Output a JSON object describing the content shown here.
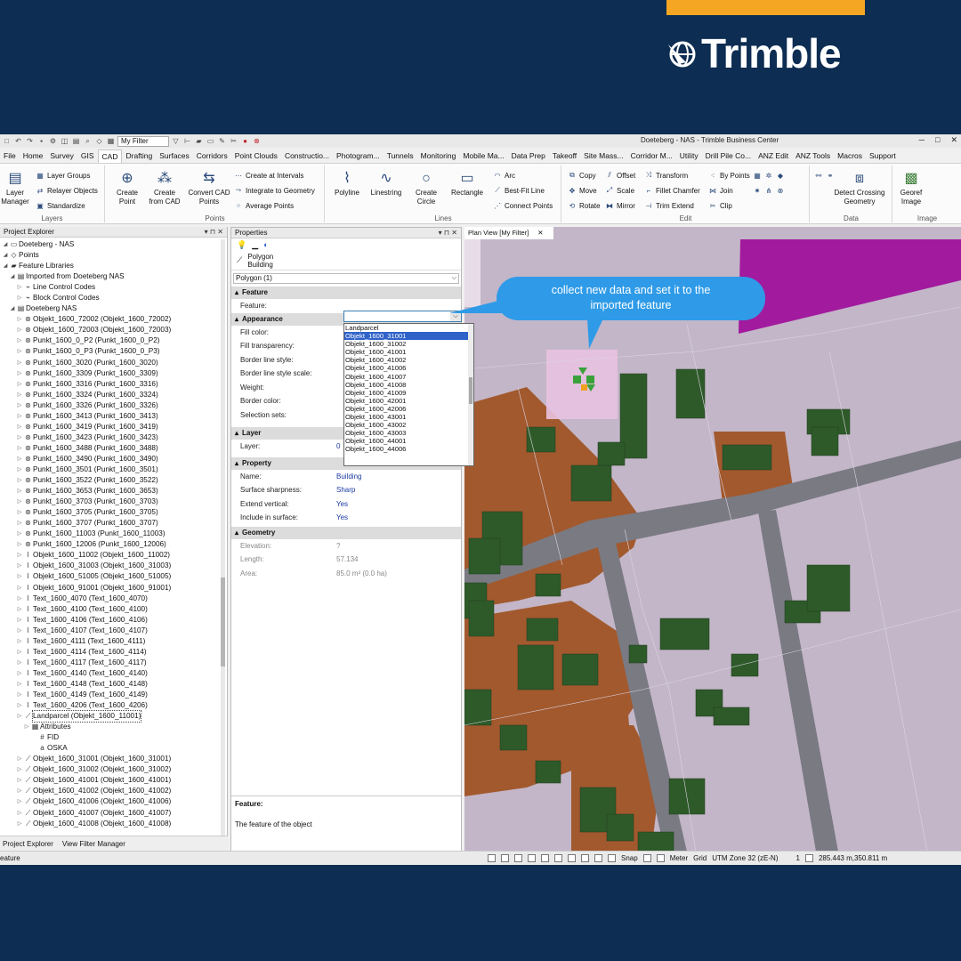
{
  "brand": {
    "name": "Trimble",
    "accent": "#f5a623",
    "background": "#0d2d52"
  },
  "window": {
    "title": "Doeteberg - NAS - Trimble Business Center",
    "filter": "My Filter"
  },
  "ribbon_tabs": [
    "File",
    "Home",
    "Survey",
    "GIS",
    "CAD",
    "Drafting",
    "Surfaces",
    "Corridors",
    "Point Clouds",
    "Constructio...",
    "Photogram...",
    "Tunnels",
    "Monitoring",
    "Mobile Ma...",
    "Data Prep",
    "Takeoff",
    "Site Mass...",
    "Corridor M...",
    "Utility",
    "Drill Pile Co...",
    "ANZ Edit",
    "ANZ Tools",
    "Macros",
    "Support"
  ],
  "active_tab": "CAD",
  "ribbon": {
    "layers": {
      "label": "Layers",
      "layer_manager": "Layer Manager",
      "layer_groups": "Layer Groups",
      "relayer": "Relayer Objects",
      "standardize": "Standardize"
    },
    "points": {
      "label": "Points",
      "create_point": "Create Point",
      "create_from_cad": "Create from CAD",
      "convert_cad": "Convert CAD Points",
      "create_intervals": "Create at Intervals",
      "integrate": "Integrate to Geometry",
      "average": "Average Points"
    },
    "lines": {
      "label": "Lines",
      "polyline": "Polyline",
      "linestring": "Linestring",
      "circle": "Create Circle",
      "rectangle": "Rectangle",
      "arc": "Arc",
      "best_fit": "Best-Fit Line",
      "connect": "Connect Points"
    },
    "edit": {
      "label": "Edit",
      "copy": "Copy",
      "offset": "Offset",
      "transform": "Transform",
      "by_points": "By Points",
      "move": "Move",
      "scale": "Scale",
      "fillet": "Fillet Chamfer",
      "join": "Join",
      "rotate": "Rotate",
      "mirror": "Mirror",
      "trim": "Trim Extend",
      "clip": "Clip"
    },
    "data": {
      "label": "Data",
      "detect": "Detect Crossing Geometry"
    },
    "image": {
      "label": "Image",
      "georef": "Georef Image"
    }
  },
  "project_explorer": {
    "title": "Project Explorer",
    "items": [
      {
        "text": "Doeteberg - NAS",
        "level": 0,
        "icon": "project-icon"
      },
      {
        "text": "Points",
        "level": 0,
        "icon": "points-icon"
      },
      {
        "text": "Feature Libraries",
        "level": 0,
        "icon": "folder-icon"
      },
      {
        "text": "Imported from Doeteberg NAS",
        "level": 1,
        "icon": "library-icon"
      },
      {
        "text": "Line Control Codes",
        "level": 2,
        "icon": "code-icon"
      },
      {
        "text": "Block Control Codes",
        "level": 2,
        "icon": "code-icon"
      },
      {
        "text": "Doeteberg NAS",
        "level": 1,
        "icon": "library-icon"
      },
      {
        "text": "Objekt_1600_72002 (Objekt_1600_72002)",
        "level": 2,
        "icon": "feature-icon"
      },
      {
        "text": "Objekt_1600_72003 (Objekt_1600_72003)",
        "level": 2,
        "icon": "feature-icon"
      },
      {
        "text": "Punkt_1600_0_P2 (Punkt_1600_0_P2)",
        "level": 2,
        "icon": "feature-icon"
      },
      {
        "text": "Punkt_1600_0_P3 (Punkt_1600_0_P3)",
        "level": 2,
        "icon": "feature-icon"
      },
      {
        "text": "Punkt_1600_3020 (Punkt_1600_3020)",
        "level": 2,
        "icon": "feature-icon"
      },
      {
        "text": "Punkt_1600_3309 (Punkt_1600_3309)",
        "level": 2,
        "icon": "feature-icon"
      },
      {
        "text": "Punkt_1600_3316 (Punkt_1600_3316)",
        "level": 2,
        "icon": "feature-icon"
      },
      {
        "text": "Punkt_1600_3324 (Punkt_1600_3324)",
        "level": 2,
        "icon": "feature-icon"
      },
      {
        "text": "Punkt_1600_3326 (Punkt_1600_3326)",
        "level": 2,
        "icon": "feature-icon"
      },
      {
        "text": "Punkt_1600_3413 (Punkt_1600_3413)",
        "level": 2,
        "icon": "feature-icon"
      },
      {
        "text": "Punkt_1600_3419 (Punkt_1600_3419)",
        "level": 2,
        "icon": "feature-icon"
      },
      {
        "text": "Punkt_1600_3423 (Punkt_1600_3423)",
        "level": 2,
        "icon": "feature-icon"
      },
      {
        "text": "Punkt_1600_3488 (Punkt_1600_3488)",
        "level": 2,
        "icon": "feature-icon"
      },
      {
        "text": "Punkt_1600_3490 (Punkt_1600_3490)",
        "level": 2,
        "icon": "feature-icon"
      },
      {
        "text": "Punkt_1600_3501 (Punkt_1600_3501)",
        "level": 2,
        "icon": "feature-icon"
      },
      {
        "text": "Punkt_1600_3522 (Punkt_1600_3522)",
        "level": 2,
        "icon": "feature-icon"
      },
      {
        "text": "Punkt_1600_3653 (Punkt_1600_3653)",
        "level": 2,
        "icon": "feature-icon"
      },
      {
        "text": "Punkt_1600_3703 (Punkt_1600_3703)",
        "level": 2,
        "icon": "feature-icon"
      },
      {
        "text": "Punkt_1600_3705 (Punkt_1600_3705)",
        "level": 2,
        "icon": "feature-icon"
      },
      {
        "text": "Punkt_1600_3707 (Punkt_1600_3707)",
        "level": 2,
        "icon": "feature-icon"
      },
      {
        "text": "Punkt_1600_11003 (Punkt_1600_11003)",
        "level": 2,
        "icon": "feature-icon"
      },
      {
        "text": "Punkt_1600_12006 (Punkt_1600_12006)",
        "level": 2,
        "icon": "feature-icon"
      },
      {
        "text": "Objekt_1600_11002 (Objekt_1600_11002)",
        "level": 2,
        "icon": "line-feature-icon"
      },
      {
        "text": "Objekt_1600_31003 (Objekt_1600_31003)",
        "level": 2,
        "icon": "line-feature-icon"
      },
      {
        "text": "Objekt_1600_51005 (Objekt_1600_51005)",
        "level": 2,
        "icon": "line-feature-icon"
      },
      {
        "text": "Objekt_1600_91001 (Objekt_1600_91001)",
        "level": 2,
        "icon": "line-feature-icon"
      },
      {
        "text": "Text_1600_4070 (Text_1600_4070)",
        "level": 2,
        "icon": "line-feature-icon"
      },
      {
        "text": "Text_1600_4100 (Text_1600_4100)",
        "level": 2,
        "icon": "line-feature-icon"
      },
      {
        "text": "Text_1600_4106 (Text_1600_4106)",
        "level": 2,
        "icon": "line-feature-icon"
      },
      {
        "text": "Text_1600_4107 (Text_1600_4107)",
        "level": 2,
        "icon": "line-feature-icon"
      },
      {
        "text": "Text_1600_4111 (Text_1600_4111)",
        "level": 2,
        "icon": "line-feature-icon"
      },
      {
        "text": "Text_1600_4114 (Text_1600_4114)",
        "level": 2,
        "icon": "line-feature-icon"
      },
      {
        "text": "Text_1600_4117 (Text_1600_4117)",
        "level": 2,
        "icon": "line-feature-icon"
      },
      {
        "text": "Text_1600_4140 (Text_1600_4140)",
        "level": 2,
        "icon": "line-feature-icon"
      },
      {
        "text": "Text_1600_4148 (Text_1600_4148)",
        "level": 2,
        "icon": "line-feature-icon"
      },
      {
        "text": "Text_1600_4149 (Text_1600_4149)",
        "level": 2,
        "icon": "line-feature-icon"
      },
      {
        "text": "Text_1600_4206 (Text_1600_4206)",
        "level": 2,
        "icon": "line-feature-icon"
      },
      {
        "text": "Landparcel (Objekt_1600_11001)",
        "level": 2,
        "icon": "polygon-feature-icon",
        "selected": true
      },
      {
        "text": "Attributes",
        "level": 3,
        "icon": "attributes-icon"
      },
      {
        "text": "FID",
        "level": 4,
        "icon": "number-attr-icon"
      },
      {
        "text": "OSKA",
        "level": 4,
        "icon": "text-attr-icon"
      },
      {
        "text": "Objekt_1600_31001 (Objekt_1600_31001)",
        "level": 2,
        "icon": "polygon-feature-icon"
      },
      {
        "text": "Objekt_1600_31002 (Objekt_1600_31002)",
        "level": 2,
        "icon": "polygon-feature-icon"
      },
      {
        "text": "Objekt_1600_41001 (Objekt_1600_41001)",
        "level": 2,
        "icon": "polygon-feature-icon"
      },
      {
        "text": "Objekt_1600_41002 (Objekt_1600_41002)",
        "level": 2,
        "icon": "polygon-feature-icon"
      },
      {
        "text": "Objekt_1600_41006 (Objekt_1600_41006)",
        "level": 2,
        "icon": "polygon-feature-icon"
      },
      {
        "text": "Objekt_1600_41007 (Objekt_1600_41007)",
        "level": 2,
        "icon": "polygon-feature-icon"
      },
      {
        "text": "Objekt_1600_41008 (Objekt_1600_41008)",
        "level": 2,
        "icon": "polygon-feature-icon"
      }
    ],
    "bottom_tabs": [
      "Project Explorer",
      "View Filter Manager"
    ]
  },
  "properties": {
    "title": "Properties",
    "object_type": "Polygon",
    "object_name": "Building",
    "selector": "Polygon (1)",
    "sections": {
      "feature": "Feature",
      "appearance": "Appearance",
      "layer": "Layer",
      "property": "Property",
      "geometry": "Geometry"
    },
    "feature_label": "Feature:",
    "appearance_rows": [
      "Fill color:",
      "Fill transparency:",
      "Border line style:",
      "Border line style scale:",
      "Weight:",
      "Border color:",
      "Selection sets:"
    ],
    "layer_row": {
      "k": "Layer:",
      "v": "0"
    },
    "property_rows": [
      {
        "k": "Name:",
        "v": "Building"
      },
      {
        "k": "Surface sharpness:",
        "v": "Sharp"
      },
      {
        "k": "Extend vertical:",
        "v": "Yes"
      },
      {
        "k": "Include in surface:",
        "v": "Yes"
      }
    ],
    "geometry_rows": [
      {
        "k": "Elevation:",
        "v": "?"
      },
      {
        "k": "Length:",
        "v": "57.134"
      },
      {
        "k": "Area:",
        "v": "85.0 m² (0.0 ha)"
      }
    ],
    "dropdown": [
      "Landparcel",
      "Objekt_1600_31001",
      "Objekt_1600_31002",
      "Objekt_1600_41001",
      "Objekt_1600_41002",
      "Objekt_1600_41006",
      "Objekt_1600_41007",
      "Objekt_1600_41008",
      "Objekt_1600_41009",
      "Objekt_1600_42001",
      "Objekt_1600_42006",
      "Objekt_1600_43001",
      "Objekt_1600_43002",
      "Objekt_1600_43003",
      "Objekt_1600_44001",
      "Objekt_1600_44006"
    ],
    "dropdown_highlight": 1,
    "help_title": "Feature:",
    "help_text": "The feature of the object"
  },
  "plan_view": {
    "tab": "Plan View [My Filter]"
  },
  "callout": {
    "line1": "collect new data and set it to the",
    "line2": "imported feature",
    "color": "#2f9be8"
  },
  "status_bar": {
    "left": "eature",
    "snap": "Snap",
    "unit": "Meter",
    "grid": "Grid",
    "zone": "UTM Zone 32 (zE-N)",
    "page": "1",
    "coords": "285.443 m,350.811 m"
  }
}
